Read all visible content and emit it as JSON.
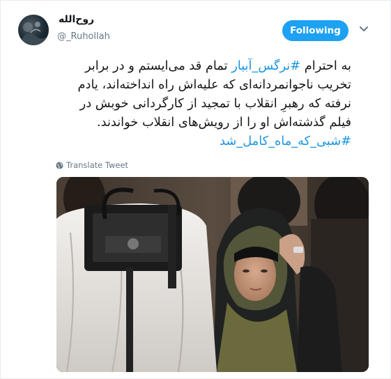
{
  "author": {
    "display_name": "روح‌الله",
    "handle": "@_Ruhollah"
  },
  "follow_button": {
    "label": "Following"
  },
  "tweet": {
    "lines": [
      {
        "parts": [
          {
            "text": "به احترام ",
            "hashtag": false
          },
          {
            "text": "#نرگس_آبیار",
            "hashtag": true
          },
          {
            "text": " تمام قد می‌ایستم و در برابر",
            "hashtag": false
          }
        ]
      },
      {
        "parts": [
          {
            "text": "تخریب ناجوانمردانه‌ای که علیه‌اش راه انداخته‌اند، یادم",
            "hashtag": false
          }
        ]
      },
      {
        "parts": [
          {
            "text": "نرفته که رهبرِ انقلاب با تمجید از کارگردانی خوبش در",
            "hashtag": false
          }
        ]
      },
      {
        "parts": [
          {
            "text": "فیلم گذشته‌اش او را از رویش‌های انقلاب خواندند.",
            "hashtag": false
          }
        ]
      },
      {
        "parts": [
          {
            "text": "#شبی_که_ماه_کامل_شد",
            "hashtag": true
          }
        ]
      }
    ]
  },
  "translate": {
    "label": "Translate Tweet",
    "icon": "globe-icon"
  },
  "icons": {
    "more": "chevron-down-icon",
    "avatar": "avatar-photo"
  },
  "colors": {
    "accent": "#1da1f2",
    "hashtag": "#1b95e0",
    "text": "#14171a",
    "muted": "#657786",
    "border": "#e6ecf0"
  }
}
